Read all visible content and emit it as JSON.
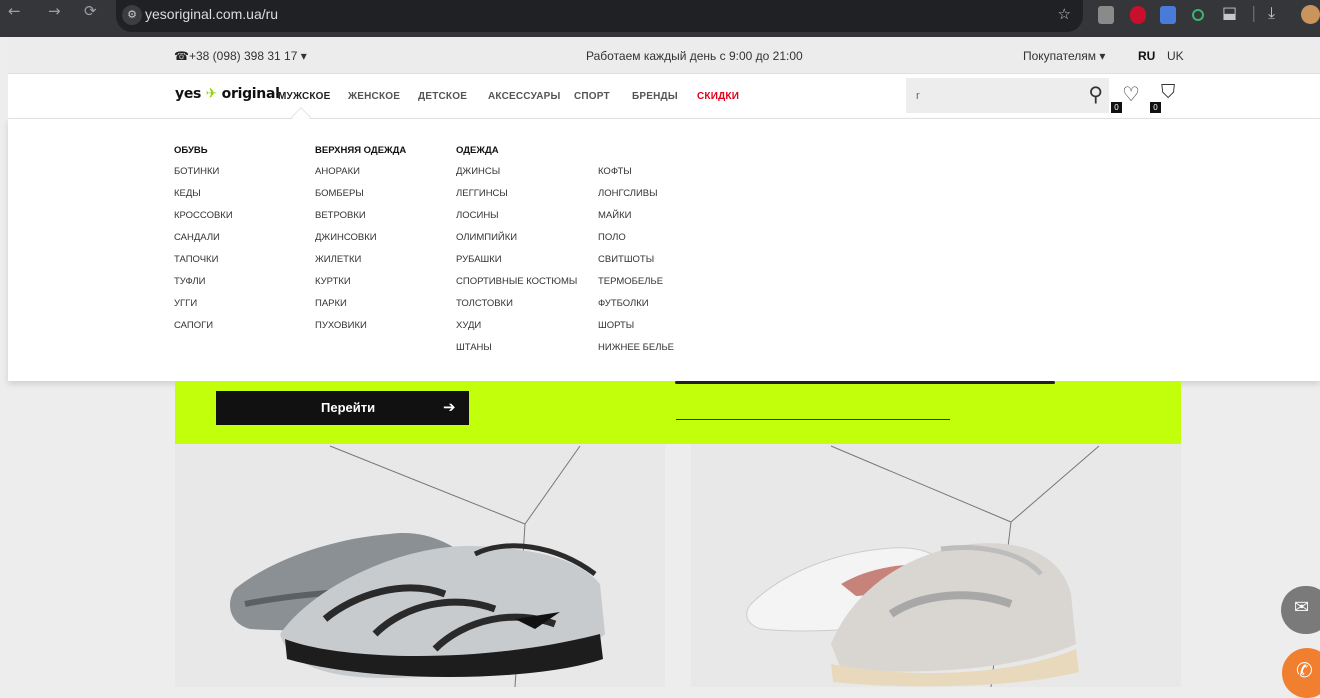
{
  "browser": {
    "back": "←",
    "forward": "→",
    "reload": "⟳",
    "site_info": "⚙",
    "url": "yesoriginal.com.ua/ru",
    "star": "☆",
    "puzzle": "⬓",
    "sep": "|",
    "download": "⤓"
  },
  "topbar": {
    "phone_icon": "☎",
    "phone": "+38 (098) 398 31 17",
    "phone_caret": "▾",
    "hours": "Работаем каждый день с 9:00 до 21:00",
    "buyers": "Покупателям",
    "buyers_caret": "▾",
    "lang_ru": "RU",
    "lang_uk": "UK"
  },
  "nav": {
    "logo_left": "yes",
    "logo_mark": "✈",
    "logo_right": "original",
    "items": [
      "МУЖСКОЕ",
      "ЖЕНСКОЕ",
      "ДЕТСКОЕ",
      "АКСЕССУАРЫ",
      "СПОРТ",
      "БРЕНДЫ",
      "СКИДКИ"
    ],
    "search_value": "r",
    "search_icon": "⚲",
    "wishlist_icon": "♡",
    "wishlist_count": "0",
    "cart_icon": "⛉",
    "cart_count": "0"
  },
  "menu": {
    "shoes": {
      "heading": "ОБУВЬ",
      "items": [
        "БОТИНКИ",
        "КЕДЫ",
        "КРОССОВКИ",
        "САНДАЛИ",
        "ТАПОЧКИ",
        "ТУФЛИ",
        "УГГИ",
        "САПОГИ"
      ]
    },
    "outerwear": {
      "heading": "ВЕРХНЯЯ ОДЕЖДА",
      "items": [
        "АНОРАКИ",
        "БОМБЕРЫ",
        "ВЕТРОВКИ",
        "ДЖИНСОВКИ",
        "ЖИЛЕТКИ",
        "КУРТКИ",
        "ПАРКИ",
        "ПУХОВИКИ"
      ]
    },
    "clothing": {
      "heading": "ОДЕЖДА",
      "items": [
        "ДЖИНСЫ",
        "ЛЕГГИНСЫ",
        "ЛОСИНЫ",
        "ОЛИМПИЙКИ",
        "РУБАШКИ",
        "СПОРТИВНЫЕ КОСТЮМЫ",
        "ТОЛСТОВКИ",
        "ХУДИ",
        "ШТАНЫ"
      ]
    },
    "clothing2": {
      "items": [
        "КОФТЫ",
        "ЛОНГСЛИВЫ",
        "МАЙКИ",
        "ПОЛО",
        "СВИТШОТЫ",
        "ТЕРМОБЕЛЬЕ",
        "ФУТБОЛКИ",
        "ШОРТЫ",
        "НИЖНЕЕ БЕЛЬЕ"
      ]
    }
  },
  "hero": {
    "button_label": "Перейти",
    "button_arrow": "➔"
  },
  "widgets": {
    "chat_icon": "✉",
    "call_icon": "✆"
  },
  "colors": {
    "accent_green": "#c2ff0a",
    "sale_red": "#e2001a"
  }
}
